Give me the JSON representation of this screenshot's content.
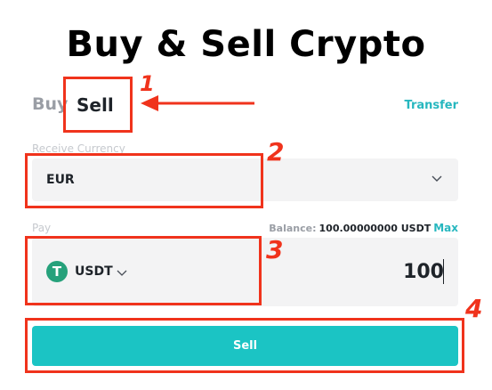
{
  "page": {
    "title": "Buy & Sell Crypto"
  },
  "tabs": {
    "buy_label": "Buy",
    "sell_label": "Sell",
    "transfer_label": "Transfer"
  },
  "receive": {
    "label": "Receive Currency",
    "selected": "EUR"
  },
  "pay": {
    "label": "Pay",
    "balance_caption": "Balance:",
    "balance_value": "100.00000000 USDT",
    "max_label": "Max",
    "coin_symbol": "USDT",
    "coin_icon_glyph": "T",
    "amount": "100"
  },
  "action": {
    "sell_button_label": "Sell"
  },
  "annotations": {
    "step1": "1",
    "step2": "2",
    "step3": "3",
    "step4": "4"
  },
  "colors": {
    "accent": "#1bc4c4",
    "link": "#27b7bf",
    "highlight": "#f0331c",
    "tether": "#26a17b"
  }
}
